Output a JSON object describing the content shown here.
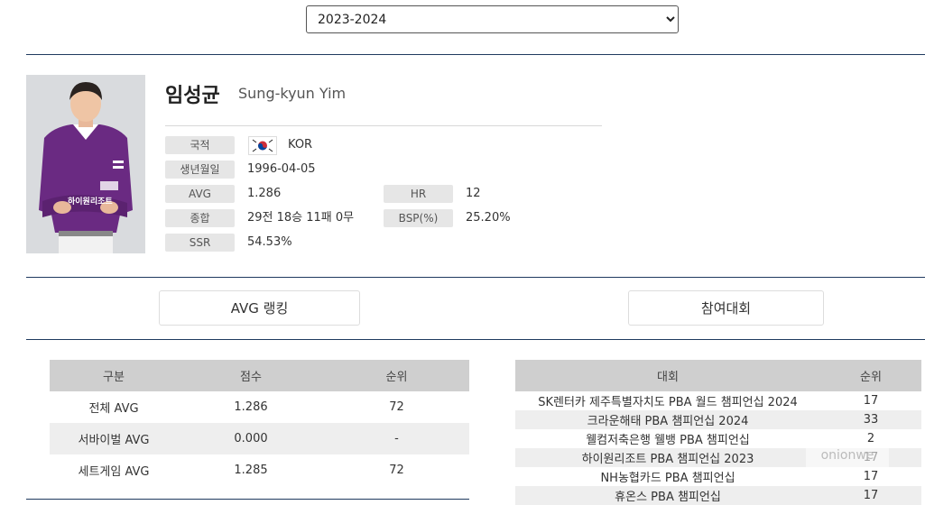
{
  "season": {
    "selected": "2023-2024"
  },
  "player": {
    "name_ko": "임성균",
    "name_en": "Sung-kyun Yim",
    "info": {
      "nationality_label": "국적",
      "nationality": "KOR",
      "birth_label": "생년월일",
      "birth": "1996-04-05",
      "avg_label": "AVG",
      "avg": "1.286",
      "hr_label": "HR",
      "hr": "12",
      "record_label": "종합",
      "record": "29전 18승 11패 0무",
      "bsp_label": "BSP(%)",
      "bsp": "25.20%",
      "ssr_label": "SSR",
      "ssr": "54.53%"
    },
    "jersey_text": "하이원리조트"
  },
  "buttons": {
    "avg_ranking": "AVG 랭킹",
    "tournaments": "참여대회"
  },
  "avg_table": {
    "headers": [
      "구분",
      "점수",
      "순위"
    ],
    "rows": [
      [
        "전체 AVG",
        "1.286",
        "72"
      ],
      [
        "서바이벌 AVG",
        "0.000",
        "-"
      ],
      [
        "세트게임 AVG",
        "1.285",
        "72"
      ]
    ]
  },
  "comp_table": {
    "headers": [
      "대회",
      "순위"
    ],
    "rows": [
      [
        "SK렌터카 제주특별자치도 PBA 월드 챔피언십 2024",
        "17"
      ],
      [
        "크라운해태 PBA 챔피언십 2024",
        "33"
      ],
      [
        "웰컴저축은행 웰뱅 PBA 챔피언십",
        "2"
      ],
      [
        "하이원리조트 PBA 챔피언십 2023",
        "17"
      ],
      [
        "NH농협카드 PBA 챔피언십",
        "17"
      ],
      [
        "휴온스 PBA 챔피언십",
        "17"
      ]
    ]
  },
  "watermark": "onionwe",
  "colors": {
    "rule": "#1f3a5f",
    "header_bg": "#cfcfcf",
    "jersey": "#6a2a82"
  },
  "icons": {
    "flag": "korea-flag-icon"
  }
}
